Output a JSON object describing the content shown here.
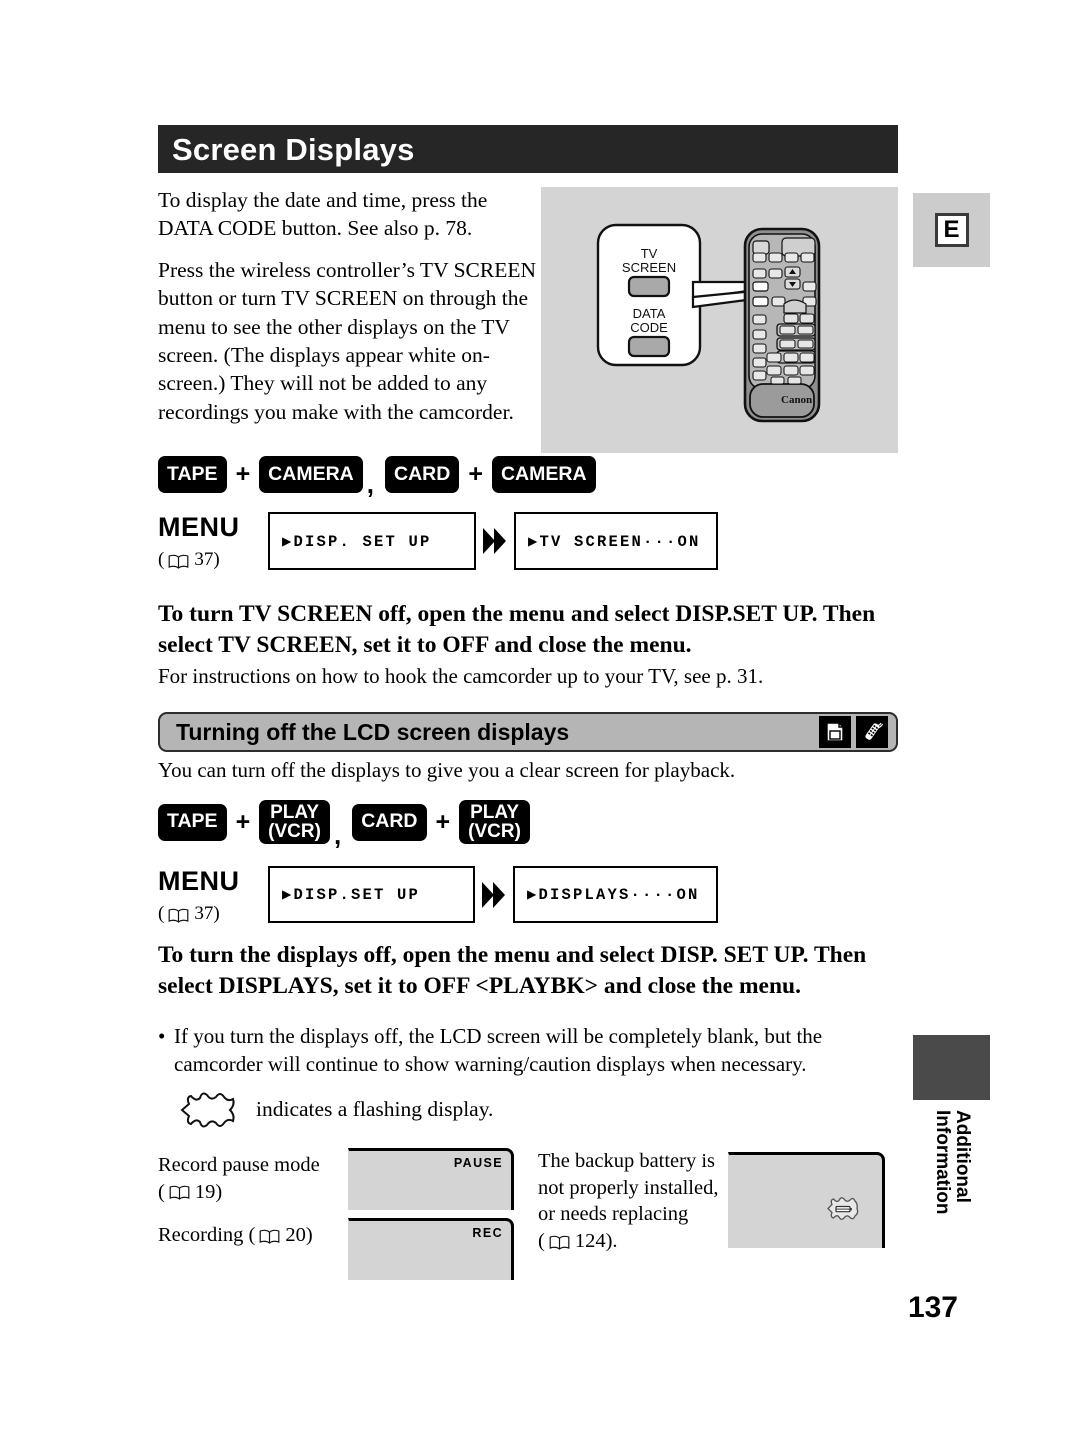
{
  "header": {
    "title": "Screen Displays"
  },
  "edge_tab": {
    "letter": "E"
  },
  "intro": {
    "paragraph_1": "To display the date and time, press the DATA CODE button. See also p. 78.",
    "paragraph_2": "Press the wireless controller’s TV SCREEN button or turn TV SCREEN on through the menu to see the other displays on the TV screen. (The displays appear white on-screen.) They will not be added to any recordings you make with the camcorder."
  },
  "illustration": {
    "callout_label_1": "TV",
    "callout_label_2": "SCREEN",
    "callout_label_3": "DATA",
    "callout_label_4": "CODE",
    "brand": "Canon",
    "icon_name": "wireless-controller-illustration"
  },
  "mode_row_1": {
    "buttons": [
      {
        "label": "TAPE",
        "lines": [
          "TAPE"
        ]
      },
      {
        "label": "CAMERA",
        "lines": [
          "CAMERA"
        ]
      },
      {
        "label": "CARD",
        "lines": [
          "CARD"
        ]
      },
      {
        "label": "CAMERA",
        "lines": [
          "CAMERA"
        ]
      }
    ],
    "plus": "+",
    "comma": ","
  },
  "menu_row_1": {
    "menu_word": "MENU",
    "ref_open": "(",
    "ref_page": "37)",
    "box_1": "▶DISP. SET UP",
    "box_2": "▶TV SCREEN···ON"
  },
  "instruction_1": {
    "bold": "To turn TV SCREEN off, open the menu and select DISP.SET UP. Then select TV SCREEN, set it to OFF and close the menu.",
    "note": "For instructions on how to hook the camcorder up to your TV, see p. 31."
  },
  "subsection": {
    "title": "Turning off the LCD screen displays",
    "icon_1": "card-tape-icon",
    "icon_2": "wireless-controller-icon",
    "note": "You can turn off the displays to give you a clear screen for playback."
  },
  "mode_row_2": {
    "buttons": [
      {
        "label": "TAPE",
        "lines": [
          "TAPE"
        ]
      },
      {
        "label": "PLAY (VCR)",
        "lines": [
          "PLAY",
          "(VCR)"
        ]
      },
      {
        "label": "CARD",
        "lines": [
          "CARD"
        ]
      },
      {
        "label": "PLAY (VCR)",
        "lines": [
          "PLAY",
          "(VCR)"
        ]
      }
    ],
    "plus": "+",
    "comma": ","
  },
  "menu_row_2": {
    "menu_word": "MENU",
    "ref_open": "(",
    "ref_page": "37)",
    "box_1": "▶DISP.SET UP",
    "box_2": "▶DISPLAYS····ON"
  },
  "instruction_2": {
    "bold": "To turn the displays off, open the menu and select DISP. SET UP. Then select DISPLAYS, set it to OFF <PLAYBK> and close the menu.",
    "bullet_dot": "•",
    "bullet": "If you turn the displays off, the LCD screen will be completely blank, but the camcorder will continue to show warning/caution displays when necessary."
  },
  "flashing_legend": {
    "icon_name": "starburst-flashing-icon",
    "label": "indicates a flashing display."
  },
  "examples": [
    {
      "caption": "Record pause mode",
      "ref_open": "(",
      "ref_page": "19)",
      "osd": "PAUSE",
      "name": "record-pause-example"
    },
    {
      "caption": "Recording (",
      "ref_page": "20)",
      "osd": "REC",
      "name": "recording-example"
    },
    {
      "caption": "The backup battery is not properly installed, or needs replacing",
      "ref_open": "(",
      "ref_page": "124).",
      "osd": "",
      "icon_name": "flashing-battery-icon",
      "name": "backup-battery-example"
    }
  ],
  "side_tab": {
    "line_1": "Additional",
    "line_2": "Information"
  },
  "footer": {
    "page_number": "137"
  },
  "colors": {
    "title_bar": "#262626",
    "illustration_bg": "#d4d4d4",
    "subsection_bg": "#b5b5b5",
    "tab_gray": "#cccccc",
    "tab_dark": "#4a4a4a",
    "button_black": "#000000"
  }
}
